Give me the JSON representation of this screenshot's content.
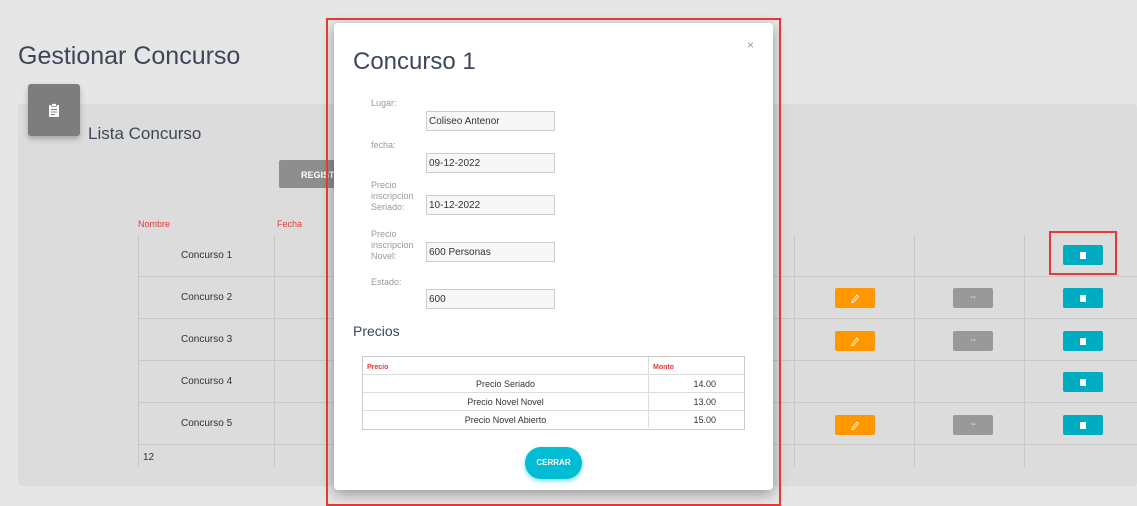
{
  "page": {
    "title": "Gestionar Concurso"
  },
  "card": {
    "title": "Lista Concurso",
    "register_label": "REGISTR"
  },
  "table": {
    "columns": [
      "Nombre",
      "Fecha"
    ],
    "rows": [
      {
        "name": "Concurso 1"
      },
      {
        "name": "Concurso 2"
      },
      {
        "name": "Concurso 3"
      },
      {
        "name": "Concurso 4"
      },
      {
        "name": "Concurso 5"
      }
    ],
    "footer_count": "12"
  },
  "modal": {
    "title": "Concurso 1",
    "close_symbol": "×",
    "fields": [
      {
        "label": "Lugar:",
        "value": "Coliseo Antenor"
      },
      {
        "label": "fecha:",
        "value": "09-12-2022"
      },
      {
        "label": "Precio inscripcion Seriado:",
        "value": "10-12-2022"
      },
      {
        "label": "Precio inscripcion Novel:",
        "value": "600 Personas"
      },
      {
        "label": "Estado:",
        "value": "600"
      }
    ],
    "prices_heading": "Precios",
    "prices_table": {
      "headers": [
        "Precio",
        "Monto"
      ],
      "rows": [
        {
          "precio": "Precio Seriado",
          "monto": "14.00"
        },
        {
          "precio": "Precio Novel Novel",
          "monto": "13.00"
        },
        {
          "precio": "Precio Novel Abierto",
          "monto": "15.00"
        }
      ]
    },
    "close_button": "CERRAR"
  },
  "colors": {
    "accent_teal": "#00acc1",
    "edit_orange": "#ff9800",
    "header_red": "#e53935",
    "highlight_red": "#e53935"
  },
  "icons": {
    "card_icon": "clipboard-icon",
    "edit_icon": "pencil-icon",
    "view_icon": "document-icon"
  }
}
